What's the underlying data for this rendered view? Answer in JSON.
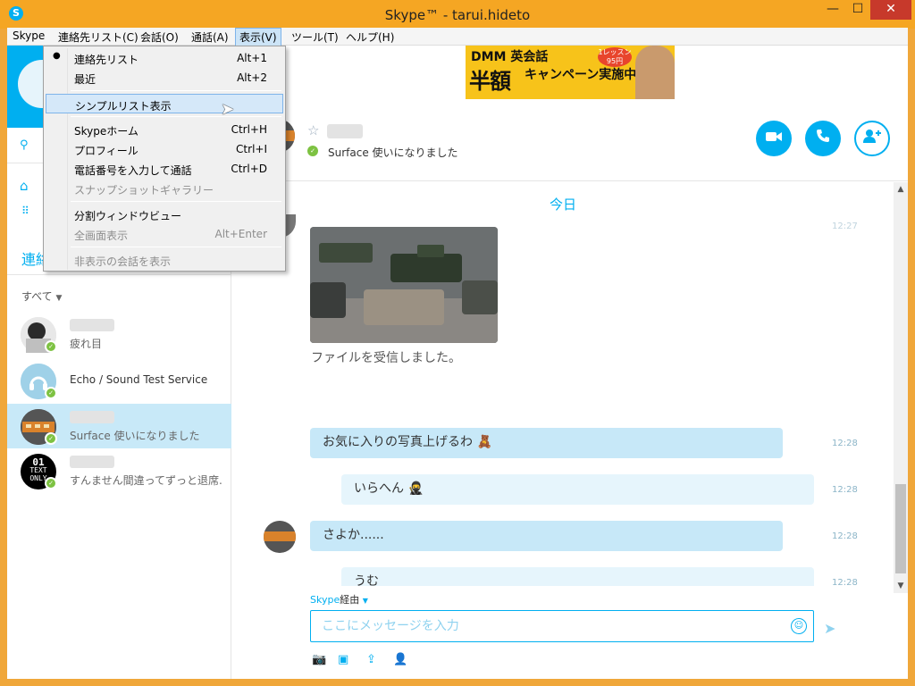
{
  "window": {
    "title": "Skype™ - tarui.hideto",
    "min": "—",
    "max": "☐",
    "close": "✕"
  },
  "menubar": [
    "Skype",
    "連絡先リスト(C)",
    "会話(O)",
    "通話(A)",
    "表示(V)",
    "ツール(T)",
    "ヘルプ(H)"
  ],
  "view_menu": [
    {
      "label": "連絡先リスト",
      "shortcut": "Alt+1",
      "checked": true
    },
    {
      "label": "最近",
      "shortcut": "Alt+2"
    },
    {
      "label": "シンプルリスト表示",
      "shortcut": ""
    },
    {
      "label": "Skypeホーム",
      "shortcut": "Ctrl+H"
    },
    {
      "label": "プロフィール",
      "shortcut": "Ctrl+I"
    },
    {
      "label": "電話番号を入力して通話",
      "shortcut": "Ctrl+D"
    },
    {
      "label": "スナップショットギャラリー",
      "shortcut": ""
    },
    {
      "label": "分割ウィンドウビュー",
      "shortcut": ""
    },
    {
      "label": "全画面表示",
      "shortcut": "Alt+Enter"
    },
    {
      "label": "非表示の会話を表示",
      "shortcut": ""
    }
  ],
  "sidebar": {
    "tab_label": "連絡",
    "filter": "すべて",
    "contacts": [
      {
        "mood": "疲れ目"
      },
      {
        "name": "Echo / Sound Test Service"
      },
      {
        "mood": "Surface 使いになりました"
      },
      {
        "mood": "すんません間違ってずっと退席..."
      }
    ],
    "text_only_avatar": {
      "line1": "01",
      "line2": "TEXT",
      "line3": "ONLY"
    }
  },
  "ad": {
    "brand": "DMM 英会話",
    "main": "半額",
    "sub": "キャンペーン実施中！",
    "badge": "1レッスン 95円"
  },
  "conversation": {
    "status": "Surface 使いになりました",
    "day_label": "今日",
    "file_note": "ファイルを受信しました。",
    "messages": [
      {
        "text": "お気に入りの写真上げるわ 🧸",
        "time": "12:28"
      },
      {
        "text": "いらへん 🥷",
        "time": "12:28"
      },
      {
        "text": "さよか......",
        "time": "12:28"
      },
      {
        "text": "うむ",
        "time": "12:28"
      }
    ],
    "via_prefix": "Skype",
    "via_suffix": "経由",
    "input_placeholder": "ここにメッセージを入力"
  },
  "colors": {
    "accent": "#00aff0",
    "online": "#7dc242",
    "titlebar": "#f5a623"
  }
}
